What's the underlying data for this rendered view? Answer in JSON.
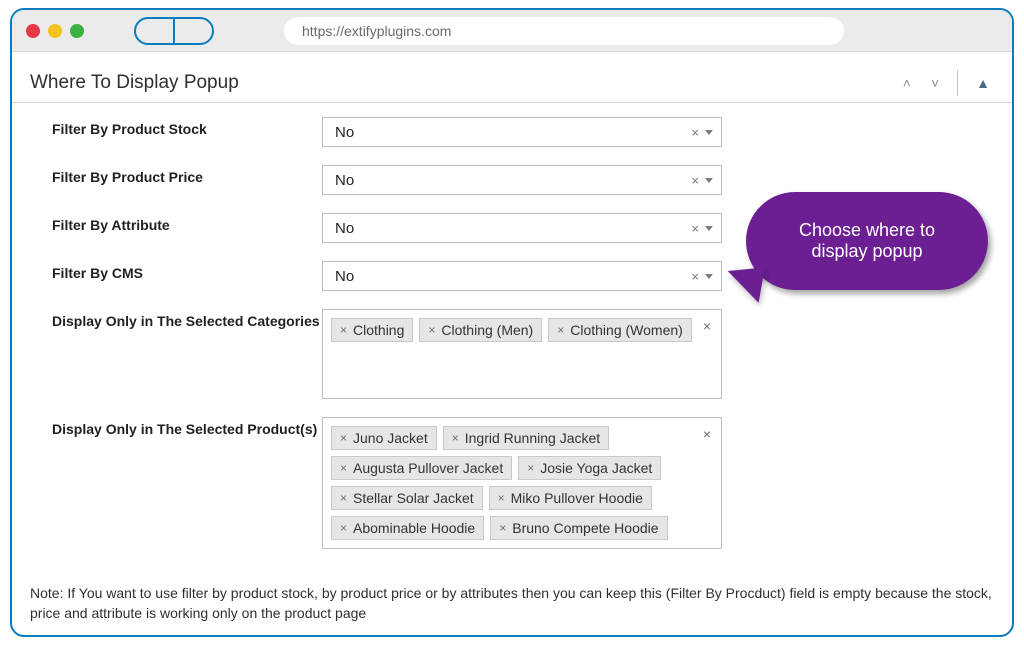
{
  "browser": {
    "url": "https://extifyplugins.com"
  },
  "section": {
    "title": "Where To Display Popup"
  },
  "callout": {
    "text": "Choose where to display popup"
  },
  "fields": {
    "stock": {
      "label": "Filter By Product Stock",
      "value": "No"
    },
    "price": {
      "label": "Filter By Product Price",
      "value": "No"
    },
    "attribute": {
      "label": "Filter By Attribute",
      "value": "No"
    },
    "cms": {
      "label": "Filter By CMS",
      "value": "No"
    },
    "categories": {
      "label": "Display Only in The Selected Categories",
      "tags": [
        "Clothing",
        "Clothing (Men)",
        "Clothing (Women)"
      ]
    },
    "products": {
      "label": "Display Only in The Selected Product(s)",
      "tags": [
        "Juno Jacket",
        "Ingrid Running Jacket",
        "Augusta Pullover Jacket",
        "Josie Yoga Jacket",
        "Stellar Solar Jacket",
        "Miko Pullover Hoodie",
        "Abominable Hoodie",
        "Bruno Compete Hoodie"
      ]
    }
  },
  "note": "Note: If You want to use filter by product stock, by product price or by attributes then you can keep this (Filter By Procduct) field is empty because the stock, price and attribute is working only on the product page",
  "glyphs": {
    "x": "×",
    "up": "˄",
    "down": "˅",
    "tri_up": "▲"
  }
}
